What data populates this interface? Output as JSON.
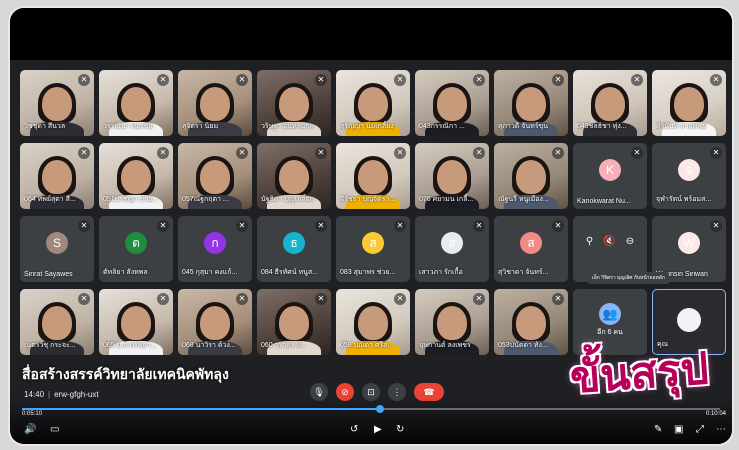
{
  "meeting": {
    "title": "สื่อสร้างสรรค์วิทยาลัยเทคนิคพัทลุง",
    "time": "14:40",
    "code": "erw-gfgh-uxt"
  },
  "overlay_text": "ขั้นสรุป",
  "tooltip": "เล็ก วิจิตรา บุญเลิศ กับหน้าจอหลัก",
  "self_tile": {
    "more_label": "อีก 6 คน",
    "name": "คุณ"
  },
  "participants": [
    {
      "name": "วิชชุดา สีนวล",
      "type": "video"
    },
    {
      "name": "วรรณิษา ทองชัย",
      "type": "video"
    },
    {
      "name": "สุจิตรา นิยม",
      "type": "video"
    },
    {
      "name": "วริษฐา อินทรนาค",
      "type": "video"
    },
    {
      "name": "สุรัญญา นิ่มเกลี้ยง",
      "type": "video"
    },
    {
      "name": "043กรรณิกา ...",
      "type": "video"
    },
    {
      "name": "สุภาวดี จันทร์ขุน",
      "type": "video"
    },
    {
      "name": "049ชลธิชา ทุ่ง...",
      "type": "video"
    },
    {
      "name": "ศิรินันท์ สายทิพย์",
      "type": "video"
    },
    {
      "name": "064 ทิพย์สุดา สี...",
      "type": "video"
    },
    {
      "name": "051ปริชญา ช่วย...",
      "type": "video"
    },
    {
      "name": "057ณัฐกฤตา ...",
      "type": "video"
    },
    {
      "name": "นัฐธิดา บุญเกลิ้ยก",
      "type": "video"
    },
    {
      "name": "จีรัชยา บุญจิตรา...",
      "type": "video"
    },
    {
      "name": "076 ศยามน เกลี้...",
      "type": "video"
    },
    {
      "name": "ณัฐนรี หนูเมือง...",
      "type": "video"
    },
    {
      "name": "Kanokwarat Nu...",
      "type": "avatar",
      "initial": "K",
      "color": "#f6aeb8"
    },
    {
      "name": "จุฬารัตน์ พร้อมส...",
      "type": "avatar",
      "initial": "จ",
      "color": "#fce8e6"
    },
    {
      "name": "Sirirat Sayawes",
      "type": "avatar",
      "initial": "S",
      "color": "#a1887f"
    },
    {
      "name": "ตัทลิยา สังทพล",
      "type": "avatar",
      "initial": "ต",
      "color": "#1e8e3e"
    },
    {
      "name": "045 กุสุมา คงแก้...",
      "type": "avatar",
      "initial": "ก",
      "color": "#9334e6"
    },
    {
      "name": "084 ธีรทัศน์ หนูส...",
      "type": "avatar",
      "initial": "ธ",
      "color": "#12b5cb"
    },
    {
      "name": "083 สุมาพร ช่วย...",
      "type": "avatar",
      "initial": "ส",
      "color": "#fcc934"
    },
    {
      "name": "เสาวภา รักเกื้อ",
      "type": "avatar",
      "initial": "ส",
      "color": "#e8eaed"
    },
    {
      "name": "สุวิชาดา จันทร์...",
      "type": "avatar",
      "initial": "ส",
      "color": "#f28b82"
    },
    {
      "name": "",
      "type": "hover"
    },
    {
      "name": "Wannsiri Siriwan",
      "type": "avatar",
      "initial": "W",
      "color": "#fce8e6"
    },
    {
      "name": "เนตรวิชุ กระจะ...",
      "type": "video"
    },
    {
      "name": "065 ม.ส.ทรัพยา...",
      "type": "video"
    },
    {
      "name": "068 นาวิรา ด้วง...",
      "type": "video"
    },
    {
      "name": "060 วราธร ห้...",
      "type": "video"
    },
    {
      "name": "058 ปณิดา ศรีส...",
      "type": "video"
    },
    {
      "name": "บุษกานต์ ลงเพชร",
      "type": "video"
    },
    {
      "name": "053ปนัดดา ทัง...",
      "type": "video"
    },
    {
      "name": "",
      "type": "more"
    },
    {
      "name": "",
      "type": "self"
    }
  ],
  "player": {
    "current_time": "0:05:10",
    "total_time": "0:10:04",
    "progress": 0.513
  },
  "colors": {
    "accent": "#3ea6ff",
    "end_call": "#ea4335",
    "overlay": "#b8005a"
  }
}
